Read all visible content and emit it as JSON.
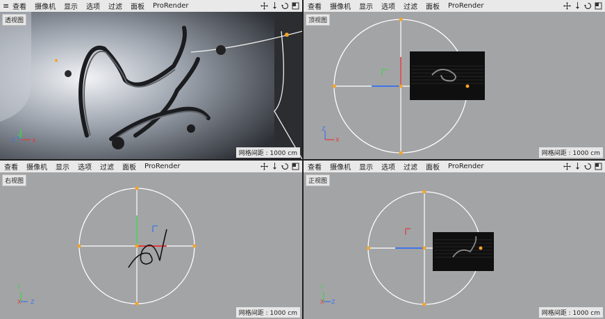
{
  "menu": {
    "items": [
      "查看",
      "摄像机",
      "显示",
      "选项",
      "过滤",
      "面板",
      "ProRender"
    ]
  },
  "viewports": {
    "perspective": {
      "label": "透视图",
      "grid_info": "网格间距 : 1000 cm"
    },
    "top": {
      "label": "顶视图",
      "grid_info": "网格间距 : 1000 cm"
    },
    "right": {
      "label": "右视图",
      "grid_info": "网格间距 : 1000 cm"
    },
    "front": {
      "label": "正视图",
      "grid_info": "网格间距 : 1000 cm"
    }
  },
  "axis_labels": {
    "x": "X",
    "y": "Y",
    "z": "Z"
  },
  "colors": {
    "viewport_bg": "#a3a4a6",
    "menu_bg": "#e9e9e9",
    "axis_x": "#e23b3b",
    "axis_y": "#3fd44a",
    "axis_z": "#3f74e8",
    "gizmo_orange": "#f4a324",
    "circle_white": "#ffffff"
  },
  "icons": {
    "toolbar": [
      "move-view-icon",
      "pan-down-icon",
      "rotate-view-icon",
      "maximize-icon"
    ]
  }
}
